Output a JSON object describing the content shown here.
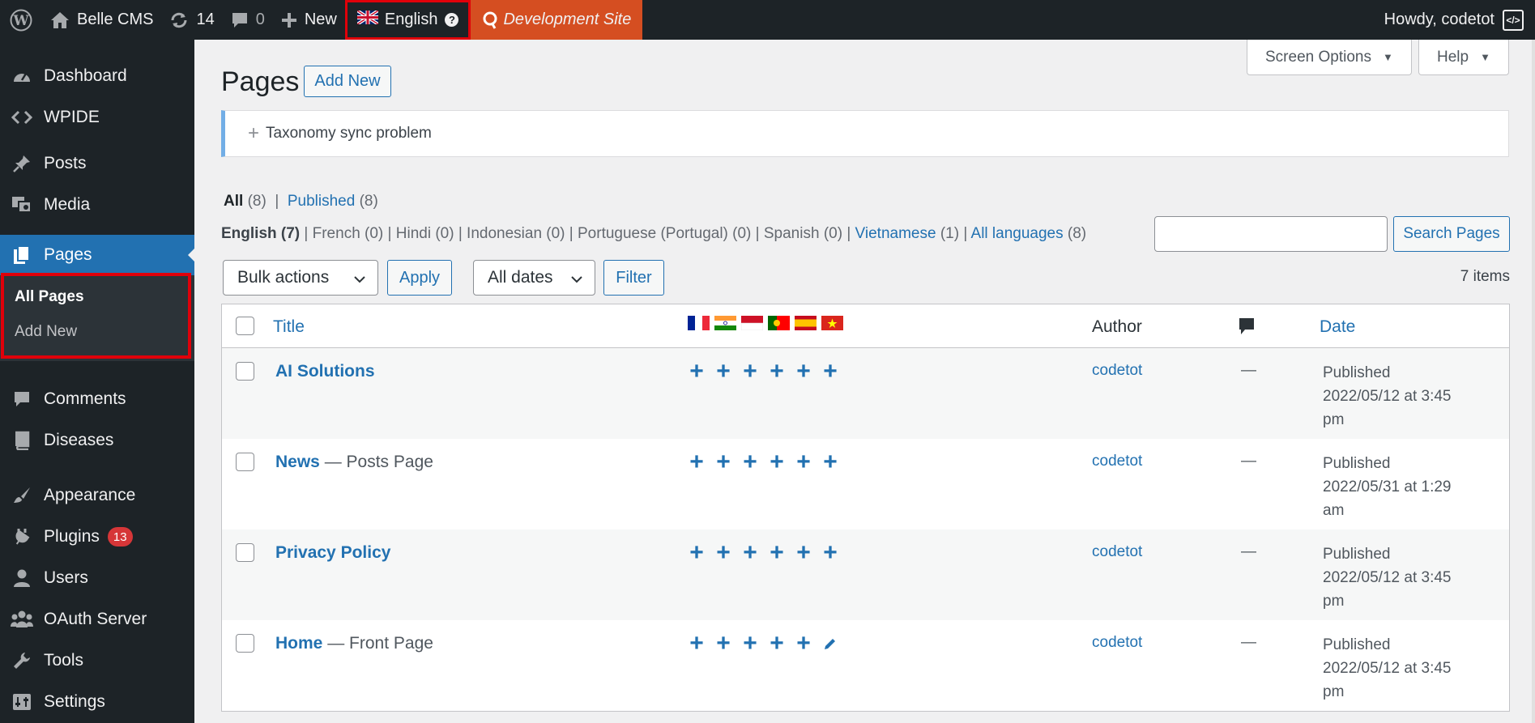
{
  "adminbar": {
    "site_name": "Belle CMS",
    "updates_count": "14",
    "comments_count": "0",
    "new_label": "New",
    "language_label": "English",
    "dev_site_label": "Development Site",
    "howdy_label": "Howdy, codetot"
  },
  "sidebar": {
    "items": [
      {
        "label": "Dashboard",
        "icon": "dashboard-icon"
      },
      {
        "label": "WPIDE",
        "icon": "code-icon"
      },
      {
        "label": "Posts",
        "icon": "pin-icon"
      },
      {
        "label": "Media",
        "icon": "media-icon"
      },
      {
        "label": "Pages",
        "icon": "pages-icon"
      },
      {
        "label": "Comments",
        "icon": "comment-icon"
      },
      {
        "label": "Diseases",
        "icon": "book-icon"
      },
      {
        "label": "Appearance",
        "icon": "brush-icon"
      },
      {
        "label": "Plugins",
        "icon": "plugin-icon",
        "badge": "13"
      },
      {
        "label": "Users",
        "icon": "user-icon"
      },
      {
        "label": "OAuth Server",
        "icon": "groups-icon"
      },
      {
        "label": "Tools",
        "icon": "wrench-icon"
      },
      {
        "label": "Settings",
        "icon": "settings-icon"
      }
    ],
    "submenu": {
      "all_pages": "All Pages",
      "add_new": "Add New"
    }
  },
  "main": {
    "screen_options": "Screen Options",
    "help": "Help",
    "title": "Pages",
    "add_new": "Add New",
    "notice": "Taxonomy sync problem",
    "status_filters": {
      "all_label": "All",
      "all_count": "(8)",
      "published_label": "Published",
      "published_count": "(8)"
    },
    "lang_filters": {
      "english": "English (7)",
      "others": "French (0) | Hindi (0) | Indonesian (0) | Portuguese (Portugal) (0) | Spanish (0) |",
      "vietnamese": "Vietnamese",
      "vietnamese_count": "(1)",
      "all_languages": "All languages",
      "all_languages_count": "(8)"
    },
    "search_button": "Search Pages",
    "bulk_actions": "Bulk actions",
    "apply": "Apply",
    "all_dates": "All dates",
    "filter": "Filter",
    "items_count": "7 items",
    "columns": {
      "title": "Title",
      "author": "Author",
      "date": "Date"
    },
    "flags": [
      "fr",
      "in",
      "id",
      "pt",
      "es",
      "vn"
    ],
    "rows": [
      {
        "title": "AI Solutions",
        "state": "",
        "author": "codetot",
        "comments": "—",
        "status": "Published",
        "date": "2022/05/12 at 3:45",
        "time_suffix": "pm"
      },
      {
        "title": "News",
        "state": " — Posts Page",
        "author": "codetot",
        "comments": "—",
        "status": "Published",
        "date": "2022/05/31 at 1:29",
        "time_suffix": "am"
      },
      {
        "title": "Privacy Policy",
        "state": "",
        "author": "codetot",
        "comments": "—",
        "status": "Published",
        "date": "2022/05/12 at 3:45",
        "time_suffix": "pm"
      },
      {
        "title": "Home",
        "state": " — Front Page",
        "author": "codetot",
        "comments": "—",
        "status": "Published",
        "date": "2022/05/12 at 3:45",
        "time_suffix": "pm"
      }
    ]
  },
  "colors": {
    "adminbar_bg": "#1d2327",
    "accent": "#2271b1",
    "dev_site": "#d54e21",
    "highlight": "#e0000a"
  }
}
